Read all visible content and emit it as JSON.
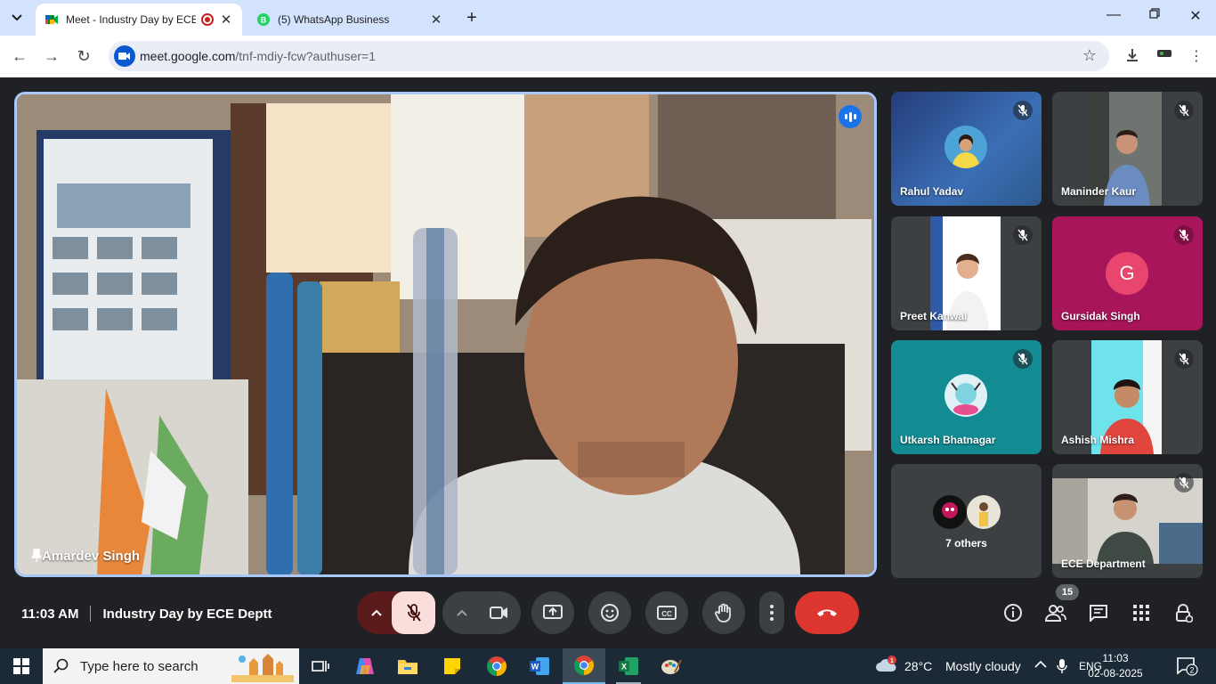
{
  "browser": {
    "tabs": [
      {
        "title": "Meet - Industry Day by ECE",
        "active": true,
        "recording": true
      },
      {
        "title": "(5) WhatsApp Business",
        "active": false
      }
    ],
    "url_host": "meet.google.com",
    "url_path": "/tnf-mdiy-fcw?authuser=1"
  },
  "meet": {
    "main_speaker": {
      "name": "Amardev Singh"
    },
    "participants": [
      {
        "name": "Rahul Yadav",
        "type": "avatar",
        "muted": true,
        "bg": "#3b5fa8"
      },
      {
        "name": "Maninder Kaur",
        "type": "camera",
        "muted": true,
        "bg": "#6b6f6e"
      },
      {
        "name": "Preet Kanwal",
        "type": "camera",
        "muted": true,
        "bg": "#3c4043"
      },
      {
        "name": "Gursidak Singh",
        "type": "letter",
        "letter": "G",
        "muted": true,
        "bg": "#a8155a"
      },
      {
        "name": "Utkarsh Bhatnagar",
        "type": "avatar",
        "muted": true,
        "bg": "#128b93"
      },
      {
        "name": "Ashish Mishra",
        "type": "camera",
        "muted": true,
        "bg": "#3c4043"
      },
      {
        "name": "7 others",
        "type": "others"
      },
      {
        "name": "ECE Department",
        "type": "camera",
        "muted": true,
        "bg": "#3c4043"
      }
    ],
    "time": "11:03 AM",
    "meeting_title": "Industry Day by ECE Deptt",
    "participant_count": "15",
    "colors": {
      "leave": "#dc362e",
      "mic_off_bg": "#f9dedc",
      "accent": "#a8c7fa"
    }
  },
  "taskbar": {
    "search_placeholder": "Type here to search",
    "weather_temp": "28°C",
    "weather_desc": "Mostly cloudy",
    "weather_badge": "1",
    "language": "ENG",
    "time": "11:03",
    "date": "02-08-2025",
    "notifications": "2"
  }
}
